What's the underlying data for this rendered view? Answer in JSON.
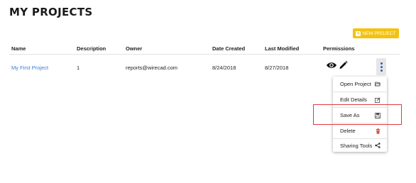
{
  "page": {
    "title": "MY PROJECTS"
  },
  "toolbar": {
    "new_project_label": "NEW PROJECT"
  },
  "table": {
    "columns": [
      "Name",
      "Description",
      "Owner",
      "Date Created",
      "Last Modified",
      "Permissions"
    ],
    "rows": [
      {
        "name": "My First Project",
        "description": "1",
        "owner": "reports@wirecad.com",
        "date_created": "8/24/2018",
        "last_modified": "8/27/2018",
        "permissions": [
          "eye-icon",
          "pencil-icon"
        ]
      }
    ]
  },
  "context_menu": {
    "items": [
      {
        "label": "Open Project",
        "icon": "folder-open-icon"
      },
      {
        "label": "Edit Details",
        "icon": "edit-icon"
      },
      {
        "label": "Save As",
        "icon": "save-icon"
      },
      {
        "label": "Delete",
        "icon": "trash-icon"
      },
      {
        "label": "Sharing Tools",
        "icon": "share-icon"
      }
    ]
  },
  "colors": {
    "accent": "#f4c20d",
    "link": "#3a7bd5",
    "highlight": "#e0393e",
    "delete_icon": "#d9534f"
  }
}
